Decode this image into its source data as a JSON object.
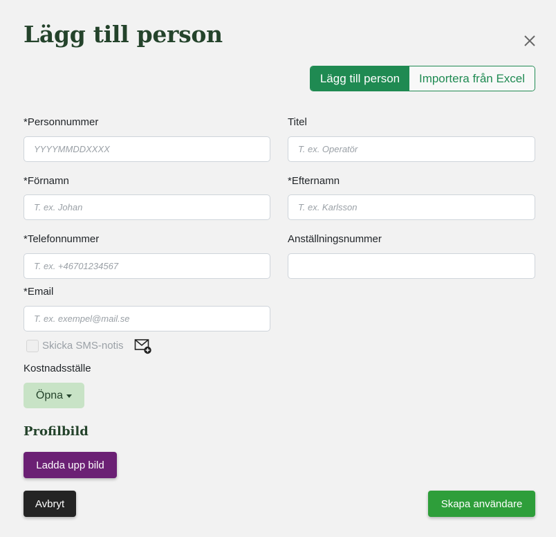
{
  "header": {
    "title": "Lägg till person"
  },
  "tabs": [
    {
      "label": "Lägg till person",
      "active": true
    },
    {
      "label": "Importera från Excel",
      "active": false
    }
  ],
  "form": {
    "personnummer": {
      "label": "*Personnummer",
      "placeholder": "YYYYMMDDXXXX",
      "value": ""
    },
    "titel": {
      "label": "Titel",
      "placeholder": "T. ex. Operatör",
      "value": ""
    },
    "fornamn": {
      "label": "*Förnamn",
      "placeholder": "T. ex. Johan",
      "value": ""
    },
    "efternamn": {
      "label": "*Efternamn",
      "placeholder": "T. ex. Karlsson",
      "value": ""
    },
    "telefon": {
      "label": "*Telefonnummer",
      "placeholder": "T. ex. +46701234567",
      "value": ""
    },
    "anstallningsnummer": {
      "label": "Anställningsnummer",
      "placeholder": "",
      "value": ""
    },
    "email": {
      "label": "*Email",
      "placeholder": "T. ex. exempel@mail.se",
      "value": ""
    },
    "sms": {
      "label": "Skicka SMS-notis",
      "checked": false,
      "icon": "mail-plus-icon"
    },
    "kostnadsstalle": {
      "label": "Kostnadsställe",
      "button_label": "Öpna"
    }
  },
  "profile": {
    "heading": "Profilbild",
    "upload_label": "Ladda upp bild"
  },
  "footer": {
    "cancel_label": "Avbryt",
    "create_label": "Skapa användare"
  },
  "colors": {
    "brand_green": "#1f8a52",
    "title_green": "#24432b",
    "upload_purple": "#6b2074",
    "create_green": "#2e9e3a",
    "dropdown_bg": "#c8e3c6"
  }
}
